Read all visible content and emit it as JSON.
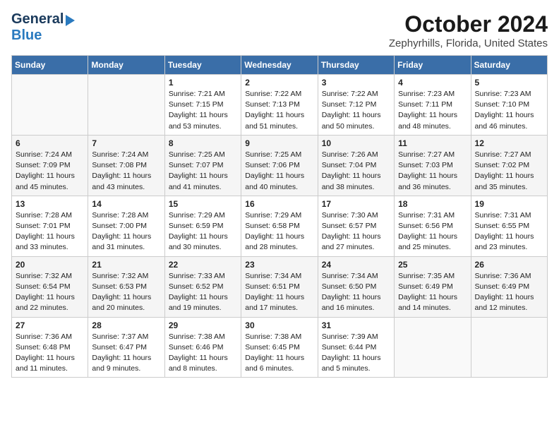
{
  "header": {
    "logo_line1": "General",
    "logo_line2": "Blue",
    "title": "October 2024",
    "subtitle": "Zephyrhills, Florida, United States"
  },
  "calendar": {
    "days_of_week": [
      "Sunday",
      "Monday",
      "Tuesday",
      "Wednesday",
      "Thursday",
      "Friday",
      "Saturday"
    ],
    "weeks": [
      [
        {
          "day": "",
          "content": ""
        },
        {
          "day": "",
          "content": ""
        },
        {
          "day": "1",
          "content": "Sunrise: 7:21 AM\nSunset: 7:15 PM\nDaylight: 11 hours\nand 53 minutes."
        },
        {
          "day": "2",
          "content": "Sunrise: 7:22 AM\nSunset: 7:13 PM\nDaylight: 11 hours\nand 51 minutes."
        },
        {
          "day": "3",
          "content": "Sunrise: 7:22 AM\nSunset: 7:12 PM\nDaylight: 11 hours\nand 50 minutes."
        },
        {
          "day": "4",
          "content": "Sunrise: 7:23 AM\nSunset: 7:11 PM\nDaylight: 11 hours\nand 48 minutes."
        },
        {
          "day": "5",
          "content": "Sunrise: 7:23 AM\nSunset: 7:10 PM\nDaylight: 11 hours\nand 46 minutes."
        }
      ],
      [
        {
          "day": "6",
          "content": "Sunrise: 7:24 AM\nSunset: 7:09 PM\nDaylight: 11 hours\nand 45 minutes."
        },
        {
          "day": "7",
          "content": "Sunrise: 7:24 AM\nSunset: 7:08 PM\nDaylight: 11 hours\nand 43 minutes."
        },
        {
          "day": "8",
          "content": "Sunrise: 7:25 AM\nSunset: 7:07 PM\nDaylight: 11 hours\nand 41 minutes."
        },
        {
          "day": "9",
          "content": "Sunrise: 7:25 AM\nSunset: 7:06 PM\nDaylight: 11 hours\nand 40 minutes."
        },
        {
          "day": "10",
          "content": "Sunrise: 7:26 AM\nSunset: 7:04 PM\nDaylight: 11 hours\nand 38 minutes."
        },
        {
          "day": "11",
          "content": "Sunrise: 7:27 AM\nSunset: 7:03 PM\nDaylight: 11 hours\nand 36 minutes."
        },
        {
          "day": "12",
          "content": "Sunrise: 7:27 AM\nSunset: 7:02 PM\nDaylight: 11 hours\nand 35 minutes."
        }
      ],
      [
        {
          "day": "13",
          "content": "Sunrise: 7:28 AM\nSunset: 7:01 PM\nDaylight: 11 hours\nand 33 minutes."
        },
        {
          "day": "14",
          "content": "Sunrise: 7:28 AM\nSunset: 7:00 PM\nDaylight: 11 hours\nand 31 minutes."
        },
        {
          "day": "15",
          "content": "Sunrise: 7:29 AM\nSunset: 6:59 PM\nDaylight: 11 hours\nand 30 minutes."
        },
        {
          "day": "16",
          "content": "Sunrise: 7:29 AM\nSunset: 6:58 PM\nDaylight: 11 hours\nand 28 minutes."
        },
        {
          "day": "17",
          "content": "Sunrise: 7:30 AM\nSunset: 6:57 PM\nDaylight: 11 hours\nand 27 minutes."
        },
        {
          "day": "18",
          "content": "Sunrise: 7:31 AM\nSunset: 6:56 PM\nDaylight: 11 hours\nand 25 minutes."
        },
        {
          "day": "19",
          "content": "Sunrise: 7:31 AM\nSunset: 6:55 PM\nDaylight: 11 hours\nand 23 minutes."
        }
      ],
      [
        {
          "day": "20",
          "content": "Sunrise: 7:32 AM\nSunset: 6:54 PM\nDaylight: 11 hours\nand 22 minutes."
        },
        {
          "day": "21",
          "content": "Sunrise: 7:32 AM\nSunset: 6:53 PM\nDaylight: 11 hours\nand 20 minutes."
        },
        {
          "day": "22",
          "content": "Sunrise: 7:33 AM\nSunset: 6:52 PM\nDaylight: 11 hours\nand 19 minutes."
        },
        {
          "day": "23",
          "content": "Sunrise: 7:34 AM\nSunset: 6:51 PM\nDaylight: 11 hours\nand 17 minutes."
        },
        {
          "day": "24",
          "content": "Sunrise: 7:34 AM\nSunset: 6:50 PM\nDaylight: 11 hours\nand 16 minutes."
        },
        {
          "day": "25",
          "content": "Sunrise: 7:35 AM\nSunset: 6:49 PM\nDaylight: 11 hours\nand 14 minutes."
        },
        {
          "day": "26",
          "content": "Sunrise: 7:36 AM\nSunset: 6:49 PM\nDaylight: 11 hours\nand 12 minutes."
        }
      ],
      [
        {
          "day": "27",
          "content": "Sunrise: 7:36 AM\nSunset: 6:48 PM\nDaylight: 11 hours\nand 11 minutes."
        },
        {
          "day": "28",
          "content": "Sunrise: 7:37 AM\nSunset: 6:47 PM\nDaylight: 11 hours\nand 9 minutes."
        },
        {
          "day": "29",
          "content": "Sunrise: 7:38 AM\nSunset: 6:46 PM\nDaylight: 11 hours\nand 8 minutes."
        },
        {
          "day": "30",
          "content": "Sunrise: 7:38 AM\nSunset: 6:45 PM\nDaylight: 11 hours\nand 6 minutes."
        },
        {
          "day": "31",
          "content": "Sunrise: 7:39 AM\nSunset: 6:44 PM\nDaylight: 11 hours\nand 5 minutes."
        },
        {
          "day": "",
          "content": ""
        },
        {
          "day": "",
          "content": ""
        }
      ]
    ]
  }
}
